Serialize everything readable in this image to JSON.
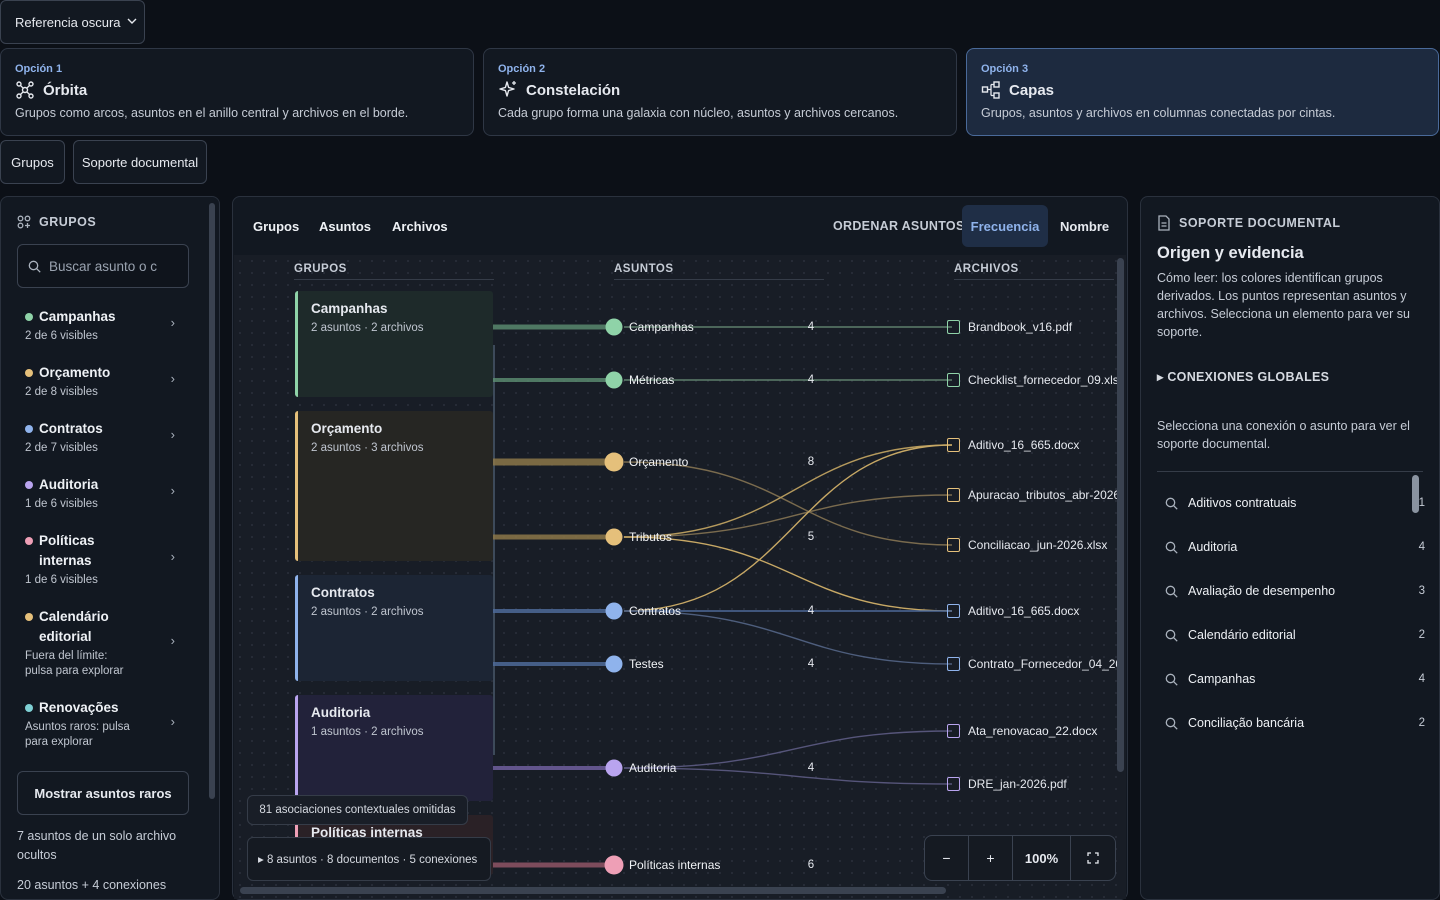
{
  "reference_select": {
    "label": "Referencia oscura"
  },
  "options": [
    {
      "num": "Opción 1",
      "title": "Órbita",
      "desc": "Grupos como arcos, asuntos en el anillo central y archivos en el borde.",
      "icon": "orbit-icon"
    },
    {
      "num": "Opción 2",
      "title": "Constelación",
      "desc": "Cada grupo forma una galaxia con núcleo, asuntos y archivos cercanos.",
      "icon": "sparkle-icon"
    },
    {
      "num": "Opción 3",
      "title": "Capas",
      "desc": "Grupos, asuntos y archivos en columnas conectadas por cintas.",
      "icon": "layers-icon",
      "selected": true
    }
  ],
  "mode_tabs": {
    "grupos": "Grupos",
    "soporte": "Soporte documental"
  },
  "left": {
    "header": "GRUPOS",
    "search_placeholder": "Buscar asunto o c",
    "groups": [
      {
        "name": "Campanhas",
        "sub": "2 de 6 visibles",
        "color": "#8fd3a8"
      },
      {
        "name": "Orçamento",
        "sub": "2 de 8 visibles",
        "color": "#e5c07b"
      },
      {
        "name": "Contratos",
        "sub": "2 de 7 visibles",
        "color": "#8fb3ec"
      },
      {
        "name": "Auditoria",
        "sub": "1 de 6 visibles",
        "color": "#b9a4ef"
      },
      {
        "name": "Políticas internas",
        "sub": "1 de 6 visibles",
        "color": "#ee9fb6"
      },
      {
        "name": "Calendário editorial",
        "sub": "Fuera del límite: pulsa para explorar",
        "color": "#e5c07b"
      },
      {
        "name": "Renovações",
        "sub": "Asuntos raros: pulsa para explorar",
        "color": "#7fd0d4"
      }
    ],
    "rare_button": "Mostrar asuntos raros",
    "hidden_note": "7 asuntos de un solo archivo ocultos",
    "total_note": "20 asuntos + 4 conexiones"
  },
  "center": {
    "tabs": [
      "Grupos",
      "Asuntos",
      "Archivos"
    ],
    "sort_label": "ORDENAR ASUNTOS",
    "sort_freq": "Frecuencia",
    "sort_name": "Nombre",
    "col_groups": "GRUPOS",
    "col_topics": "ASUNTOS",
    "col_files": "ARCHIVOS",
    "group_boxes": [
      {
        "name": "Campanhas",
        "sub": "2 asuntos · 2 archivos",
        "color": "#8fd3a8"
      },
      {
        "name": "Orçamento",
        "sub": "2 asuntos · 3 archivos",
        "color": "#e5c07b"
      },
      {
        "name": "Contratos",
        "sub": "2 asuntos · 2 archivos",
        "color": "#8fb3ec"
      },
      {
        "name": "Auditoria",
        "sub": "1 asuntos · 2 archivos",
        "color": "#b9a4ef"
      },
      {
        "name": "Políticas internas",
        "sub": "",
        "color": "#ee9fb6"
      }
    ],
    "topics": [
      {
        "name": "Campanhas",
        "count": "4"
      },
      {
        "name": "Métricas",
        "count": "4"
      },
      {
        "name": "Orçamento",
        "count": "8"
      },
      {
        "name": "Tributos",
        "count": "5"
      },
      {
        "name": "Contratos",
        "count": "4"
      },
      {
        "name": "Testes",
        "count": "4"
      },
      {
        "name": "Auditoria",
        "count": "4"
      },
      {
        "name": "Políticas internas",
        "count": "6"
      }
    ],
    "files": [
      "Brandbook_v16.pdf",
      "Checklist_fornecedor_09.xls",
      "Aditivo_16_665.docx",
      "Apuracao_tributos_abr-2026",
      "Conciliacao_jun-2026.xlsx",
      "Aditivo_16_665.docx",
      "Contrato_Fornecedor_04_20",
      "Ata_renovacao_22.docx",
      "DRE_jan-2026.pdf"
    ],
    "omitted_note": "81 asociaciones contextuales omitidas",
    "summary": "▸ 8 asuntos · 8 documentos · 5 conexiones",
    "zoom_level": "100%"
  },
  "right": {
    "header": "SOPORTE DOCUMENTAL",
    "title": "Origen y evidencia",
    "intro": "Cómo leer: los colores identifican grupos derivados. Los puntos representan asuntos y archivos. Selecciona un elemento para ver su soporte.",
    "connections_header": "▸ CONEXIONES GLOBALES",
    "select_note": "Selecciona una conexión o asunto para ver el soporte documental.",
    "items": [
      {
        "label": "Aditivos contratuais",
        "count": "1"
      },
      {
        "label": "Auditoria",
        "count": "4"
      },
      {
        "label": "Avaliação de desempenho",
        "count": "3"
      },
      {
        "label": "Calendário editorial",
        "count": "2"
      },
      {
        "label": "Campanhas",
        "count": "4"
      },
      {
        "label": "Conciliação bancária",
        "count": "2"
      }
    ]
  }
}
